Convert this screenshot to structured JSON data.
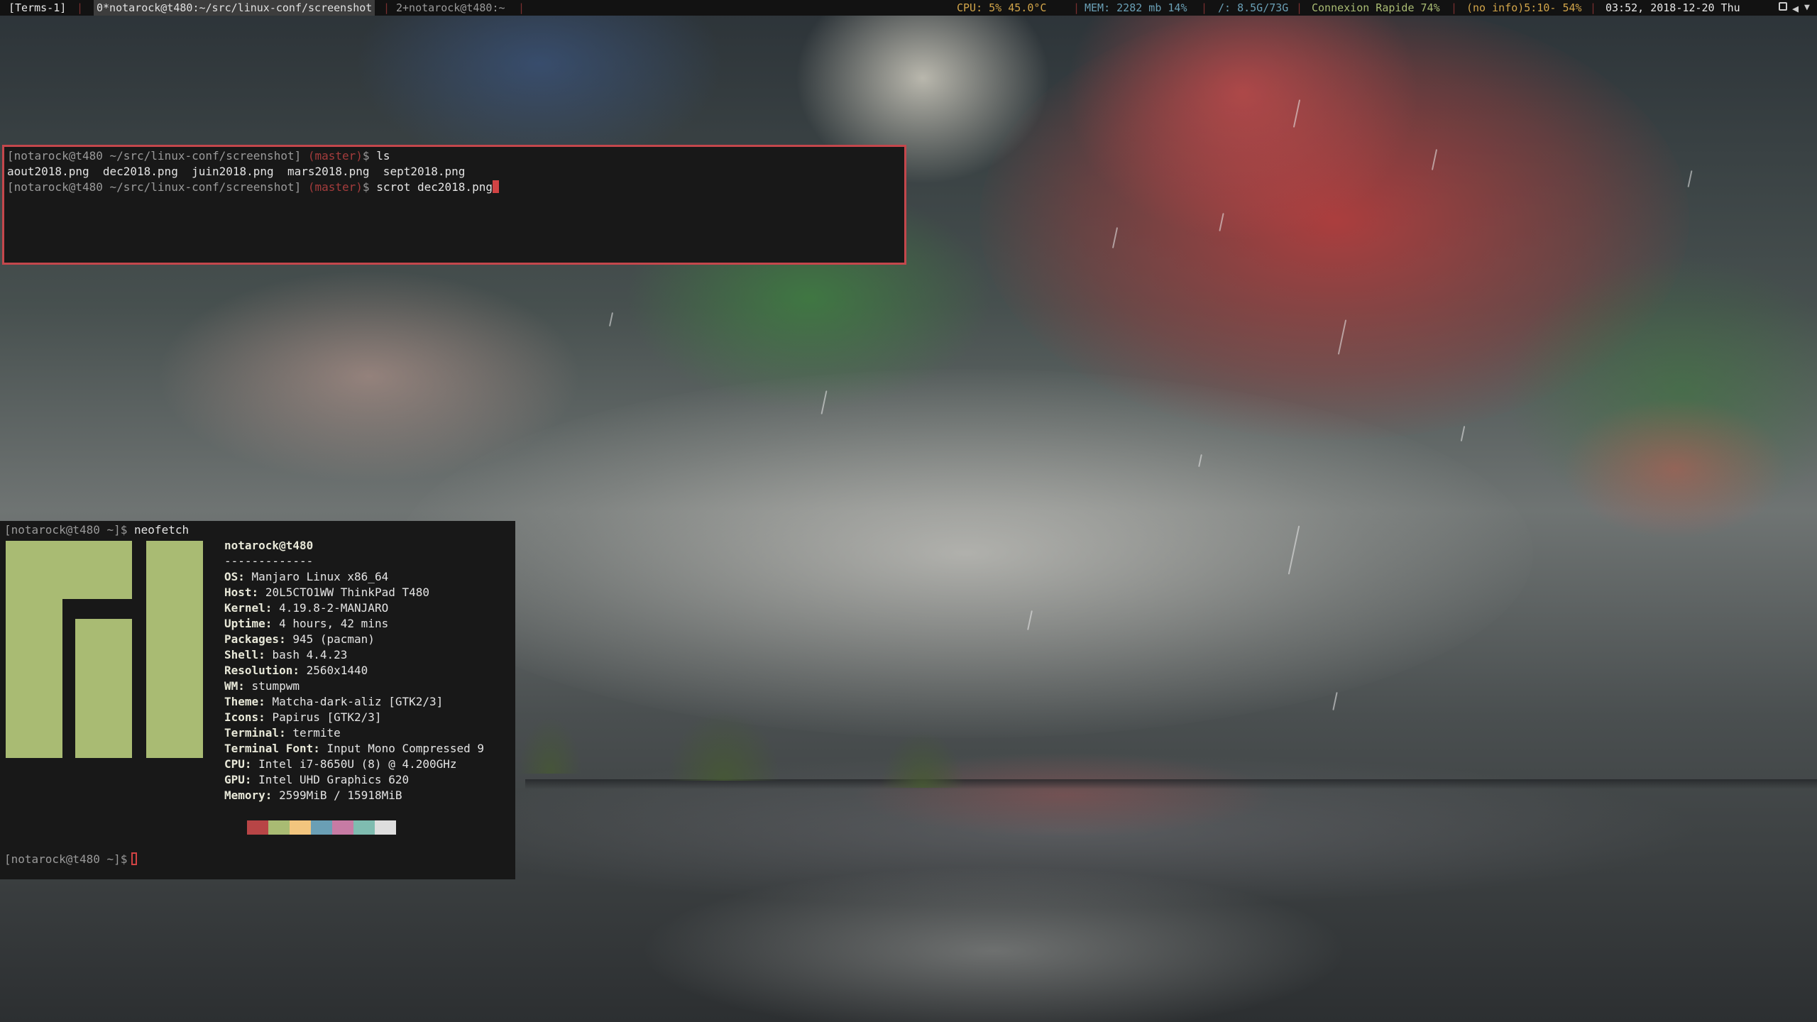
{
  "statusbar": {
    "workspace_group": "[Terms-1]",
    "active_window": "0*notarock@t480:~/src/linux-conf/screenshot",
    "inactive_window": "2+notarock@t480:~",
    "cpu": "CPU:   5% 45.0°C",
    "mem": "MEM: 2282 mb  14%",
    "disk": "/: 8.5G/73G",
    "wifi": "Connexion Rapide 74%",
    "battery": "(no info)5:10- 54%",
    "clock": "03:52, 2018-12-20 Thu"
  },
  "terminal_top": {
    "line1": {
      "user": "[notarock@t480",
      "path": "~/src/linux-conf/screenshot]",
      "branch": "(master)",
      "prompt": "$",
      "cmd": "ls"
    },
    "ls_output": "aout2018.png  dec2018.png  juin2018.png  mars2018.png  sept2018.png",
    "line3": {
      "user": "[notarock@t480",
      "path": "~/src/linux-conf/screenshot]",
      "branch": "(master)",
      "prompt": "$",
      "cmd": "scrot dec2018.png"
    }
  },
  "terminal_bottom": {
    "first_prompt": "[notarock@t480 ~]$",
    "first_cmd": "neofetch",
    "userhost": "notarock@t480",
    "separator": "-------------",
    "info": [
      {
        "key": "OS:",
        "value": "Manjaro Linux x86_64"
      },
      {
        "key": "Host:",
        "value": "20L5CTO1WW ThinkPad T480"
      },
      {
        "key": "Kernel:",
        "value": "4.19.8-2-MANJARO"
      },
      {
        "key": "Uptime:",
        "value": "4 hours, 42 mins"
      },
      {
        "key": "Packages:",
        "value": "945 (pacman)"
      },
      {
        "key": "Shell:",
        "value": "bash 4.4.23"
      },
      {
        "key": "Resolution:",
        "value": "2560x1440"
      },
      {
        "key": "WM:",
        "value": "stumpwm"
      },
      {
        "key": "Theme:",
        "value": "Matcha-dark-aliz [GTK2/3]"
      },
      {
        "key": "Icons:",
        "value": "Papirus [GTK2/3]"
      },
      {
        "key": "Terminal:",
        "value": "termite"
      },
      {
        "key": "Terminal Font:",
        "value": "Input Mono Compressed 9"
      },
      {
        "key": "CPU:",
        "value": "Intel i7-8650U (8) @ 4.200GHz"
      },
      {
        "key": "GPU:",
        "value": "Intel UHD Graphics 620"
      },
      {
        "key": "Memory:",
        "value": "2599MiB / 15918MiB"
      }
    ],
    "swatch_colors": [
      "#b84546",
      "#a9bb73",
      "#f2c57e",
      "#6a9fb5",
      "#c77ba4",
      "#7fbcb0",
      "#dedede"
    ],
    "last_prompt": "[notarock@t480 ~]$"
  },
  "colors": {
    "accent": "#c4474c",
    "logo": "#a9bb73",
    "terminal_bg": "#181818",
    "bar_bg": "#121212"
  }
}
